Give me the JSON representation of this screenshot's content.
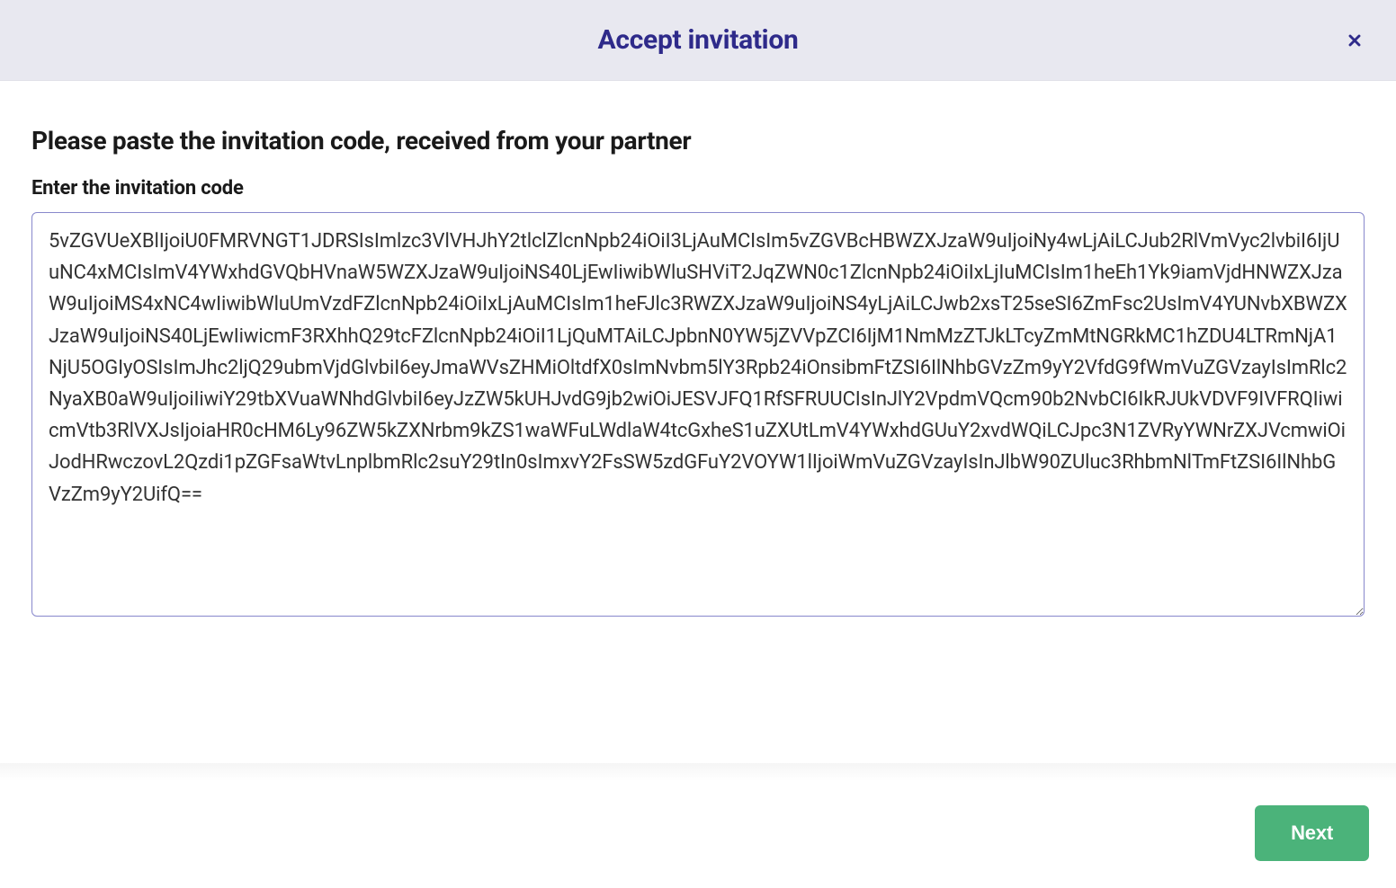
{
  "modal": {
    "title": "Accept invitation",
    "prompt_heading": "Please paste the invitation code, received from your partner",
    "field_label": "Enter the invitation code",
    "code_value": "5vZGVUeXBlIjoiU0FMRVNGT1JDRSIsImlzc3VlVHJhY2tlclZlcnNpb24iOiI3LjAuMCIsIm5vZGVBcHBWZXJzaW9uIjoiNy4wLjAiLCJub2RlVmVyc2lvbiI6IjUuNC4xMCIsImV4YWxhdGVQbHVnaW5WZXJzaW9uIjoiNS40LjEwIiwibWluSHViT2JqZWN0c1ZlcnNpb24iOiIxLjIuMCIsIm1heEh1Yk9iamVjdHNWZXJzaW9uIjoiMS4xNC4wIiwibWluUmVzdFZlcnNpb24iOiIxLjAuMCIsIm1heFJlc3RWZXJzaW9uIjoiNS4yLjAiLCJwb2xsT25seSI6ZmFsc2UsImV4YUNvbXBWZXJzaW9uIjoiNS40LjEwIiwicmF3RXhhQ29tcFZlcnNpb24iOiI1LjQuMTAiLCJpbnN0YW5jZVVpZCI6IjM1NmMzZTJkLTcyZmMtNGRkMC1hZDU4LTRmNjA1NjU5OGIyOSIsImJhc2ljQ29ubmVjdGlvbiI6eyJmaWVsZHMiOltdfX0sImNvbm5lY3Rpb24iOnsibmFtZSI6IlNhbGVzZm9yY2VfdG9fWmVuZGVzayIsImRlc2NyaXB0aW9uIjoiIiwiY29tbXVuaWNhdGlvbiI6eyJzZW5kUHJvdG9jb2wiOiJESVJFQ1RfSFRUUCIsInJlY2VpdmVQcm90b2NvbCI6IkRJUkVDVF9IVFRQIiwicmVtb3RlVXJsIjoiaHR0cHM6Ly96ZW5kZXNrbm9kZS1waWFuLWdlaW4tcGxheS1uZXUtLmV4YWxhdGUuY2xvdWQiLCJpc3N1ZVRyYWNrZXJVcmwiOiJodHRwczovL2Qzdi1pZGFsaWtvLnplbmRlc2suY29tIn0sImxvY2FsSW5zdGFuY2VOYW1lIjoiWmVuZGVzayIsInJlbW90ZUluc3RhbmNlTmFtZSI6IlNhbGVzZm9yY2UifQ==",
    "next_button_label": "Next"
  }
}
